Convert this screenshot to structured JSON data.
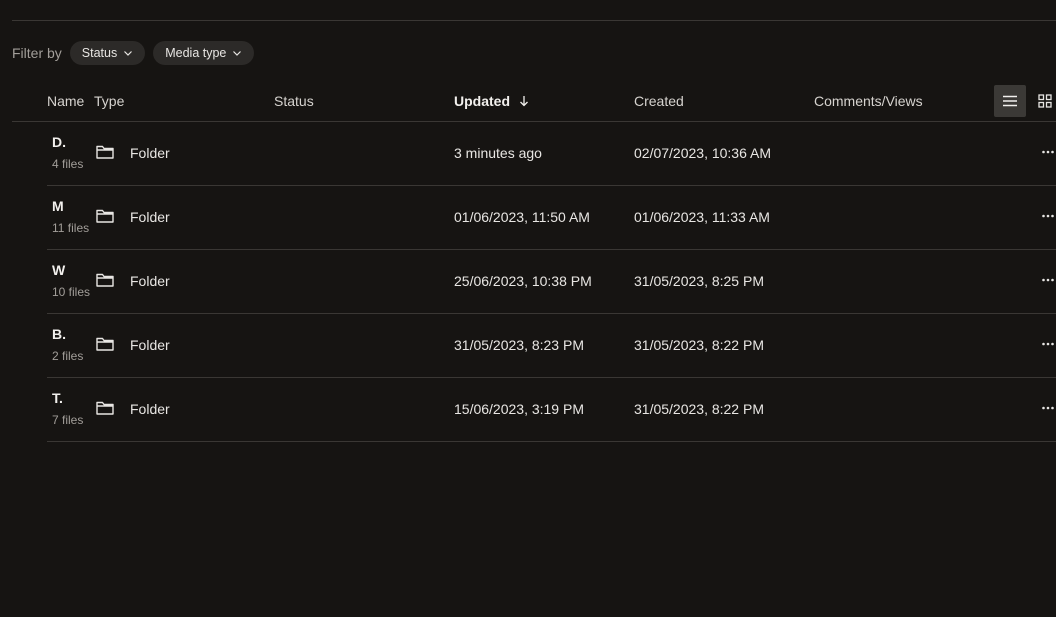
{
  "filters": {
    "label": "Filter by",
    "chips": [
      {
        "label": "Status"
      },
      {
        "label": "Media type"
      }
    ]
  },
  "columns": {
    "name": "Name",
    "type": "Type",
    "status": "Status",
    "updated": "Updated",
    "created": "Created",
    "comments_views": "Comments/Views"
  },
  "rows": [
    {
      "name": "D.",
      "count": "4 files",
      "type": "Folder",
      "updated": "3 minutes ago",
      "created": "02/07/2023, 10:36 AM"
    },
    {
      "name": "M",
      "count": "11 files",
      "type": "Folder",
      "updated": "01/06/2023, 11:50 AM",
      "created": "01/06/2023, 11:33 AM"
    },
    {
      "name": "W",
      "count": "10 files",
      "type": "Folder",
      "updated": "25/06/2023, 10:38 PM",
      "created": "31/05/2023, 8:25 PM"
    },
    {
      "name": "B.",
      "count": "2 files",
      "type": "Folder",
      "updated": "31/05/2023, 8:23 PM",
      "created": "31/05/2023, 8:22 PM"
    },
    {
      "name": "T.",
      "count": "7 files",
      "type": "Folder",
      "updated": "15/06/2023, 3:19 PM",
      "created": "31/05/2023, 8:22 PM"
    }
  ],
  "icons": {
    "chip_caret": "chevron-down-icon",
    "sort": "arrow-down-icon",
    "list_view": "list-view-icon",
    "grid_view": "grid-view-icon",
    "folder": "folder-icon",
    "more": "more-icon"
  }
}
